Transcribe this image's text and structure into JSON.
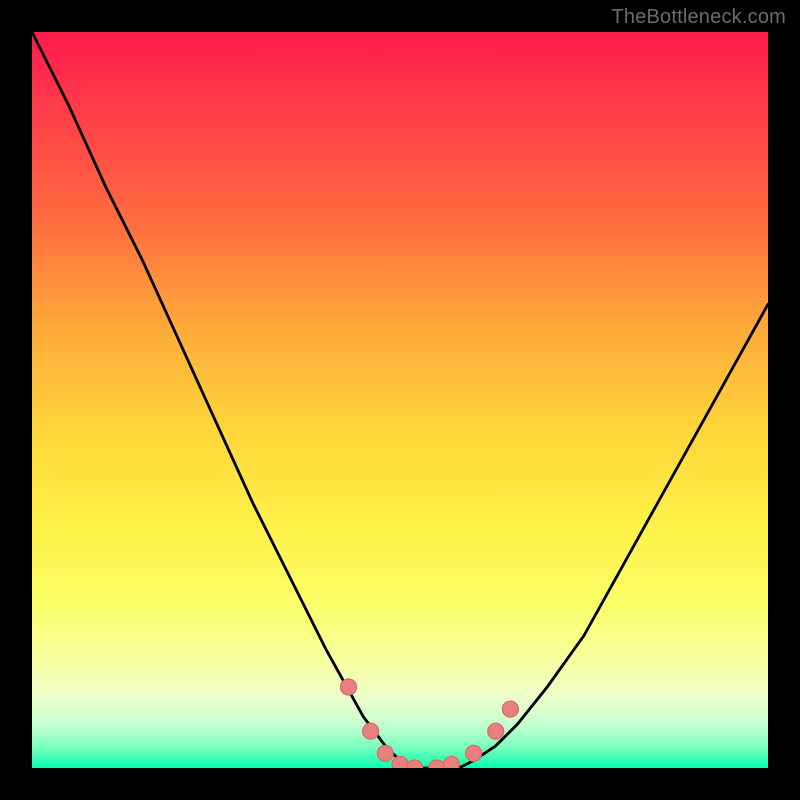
{
  "watermark": "TheBottleneck.com",
  "colors": {
    "frame": "#000000",
    "curve": "#000000",
    "marker_fill": "#e98080",
    "marker_stroke": "#d86868",
    "gradient_top": "#ff1a4d",
    "gradient_mid": "#fff24a",
    "gradient_bottom": "#00ffb0"
  },
  "chart_data": {
    "type": "line",
    "title": "",
    "xlabel": "",
    "ylabel": "",
    "xlim": [
      0,
      100
    ],
    "ylim": [
      0,
      100
    ],
    "grid": false,
    "legend": false,
    "series": [
      {
        "name": "curve",
        "x": [
          0,
          5,
          10,
          15,
          20,
          25,
          30,
          35,
          40,
          45,
          48,
          50,
          52,
          55,
          58,
          60,
          63,
          66,
          70,
          75,
          80,
          85,
          90,
          95,
          100
        ],
        "y": [
          100,
          90,
          79,
          69,
          58,
          47,
          36,
          26,
          16,
          7,
          3,
          1,
          0,
          0,
          0,
          1,
          3,
          6,
          11,
          18,
          27,
          36,
          45,
          54,
          63
        ]
      }
    ],
    "markers": [
      {
        "x": 43,
        "y": 11
      },
      {
        "x": 46,
        "y": 5
      },
      {
        "x": 48,
        "y": 2
      },
      {
        "x": 50,
        "y": 0.5
      },
      {
        "x": 52,
        "y": 0
      },
      {
        "x": 55,
        "y": 0
      },
      {
        "x": 57,
        "y": 0.5
      },
      {
        "x": 60,
        "y": 2
      },
      {
        "x": 63,
        "y": 5
      },
      {
        "x": 65,
        "y": 8
      }
    ],
    "annotations": [
      {
        "text": "TheBottleneck.com",
        "position": "top-right"
      }
    ]
  }
}
